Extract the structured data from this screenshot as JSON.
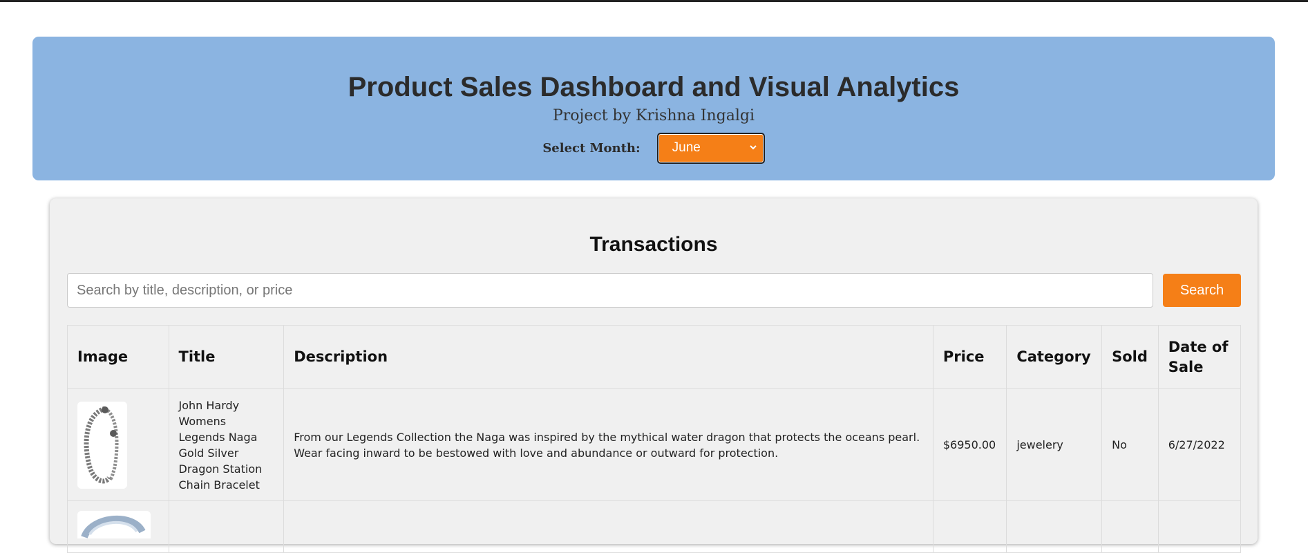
{
  "header": {
    "title": "Product Sales Dashboard and Visual Analytics",
    "subtitle": "Project by Krishna Ingalgi",
    "month_label": "Select Month:",
    "selected_month": "June",
    "accent_color": "#f57f17",
    "header_color": "#8bb4e1"
  },
  "transactions": {
    "title": "Transactions",
    "search_placeholder": "Search by title, description, or price",
    "search_button": "Search",
    "columns": [
      "Image",
      "Title",
      "Description",
      "Price",
      "Category",
      "Sold",
      "Date of Sale"
    ],
    "rows": [
      {
        "image": "bracelet-image",
        "title": "John Hardy Womens Legends Naga Gold Silver Dragon Station Chain Bracelet",
        "description": "From our Legends Collection the Naga was inspired by the mythical water dragon that protects the oceans pearl. Wear facing inward to be bestowed with love and abundance or outward for protection.",
        "price": "$6950.00",
        "category": "jewelery",
        "sold": "No",
        "date": "6/27/2022"
      },
      {
        "image": "ring-image",
        "title": "",
        "description": "",
        "price": "",
        "category": "",
        "sold": "",
        "date": ""
      }
    ]
  }
}
